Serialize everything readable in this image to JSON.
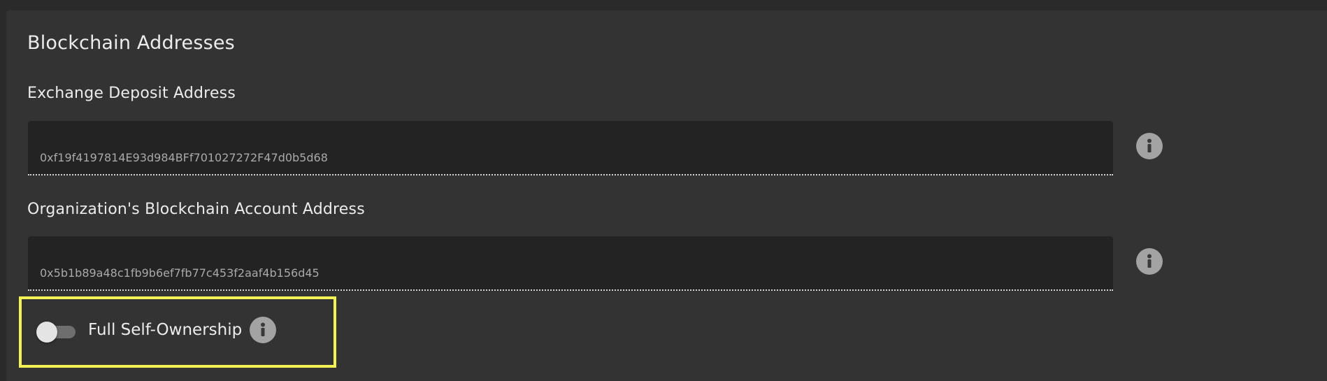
{
  "section": {
    "title": "Blockchain Addresses"
  },
  "fields": [
    {
      "label": "Exchange Deposit Address",
      "value": "0xf19f4197814E93d984BFf701027272F47d0b5d68"
    },
    {
      "label": "Organization's Blockchain Account Address",
      "value": "0x5b1b89a48c1fb9b6ef7fb77c453f2aaf4b156d45"
    }
  ],
  "self_ownership": {
    "label": "Full Self-Ownership",
    "enabled": false
  },
  "icons": {
    "info": "info-icon"
  },
  "colors": {
    "background": "#333333",
    "field_background": "#232323",
    "highlight_border": "#f2f254",
    "info_icon": "#a3a3a3"
  }
}
